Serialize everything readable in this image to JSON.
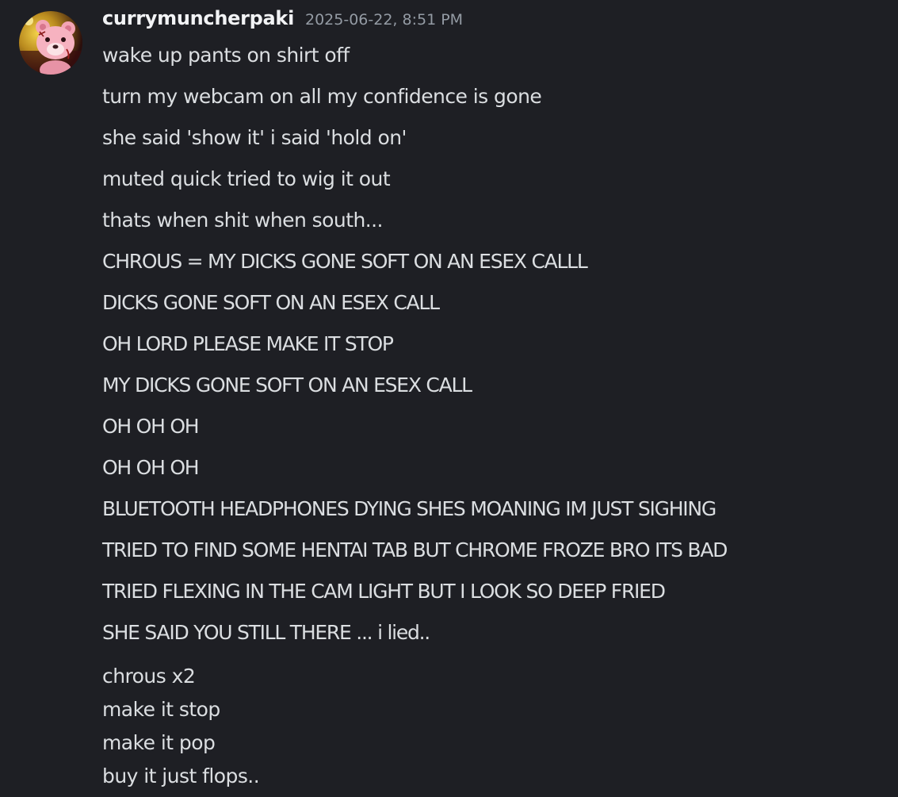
{
  "message": {
    "author": {
      "username": "currymuncherpaki",
      "avatar_icon": "pink-bear-avatar-icon"
    },
    "timestamp": "2025-06-22, 8:51 PM",
    "lines": [
      "wake up pants on shirt off",
      "turn my webcam on all my confidence is gone",
      "she said 'show it' i said 'hold on'",
      "muted quick tried to wig it out",
      "thats when shit when south...",
      "CHROUS = MY DICKS GONE SOFT ON AN ESEX CALLL",
      "DICKS GONE SOFT ON AN ESEX CALL",
      "OH LORD PLEASE MAKE IT STOP",
      "MY DICKS GONE SOFT ON AN ESEX CALL",
      "OH OH OH",
      "OH OH OH",
      "BLUETOOTH HEADPHONES DYING SHES MOANING IM JUST SIGHING",
      "TRIED TO FIND SOME HENTAI TAB BUT CHROME FROZE BRO ITS BAD",
      "TRIED FLEXING IN THE CAM LIGHT BUT I LOOK SO DEEP FRIED",
      "SHE SAID YOU STILL THERE ... i lied.."
    ],
    "final_message": [
      "chrous x2",
      "make it stop",
      "make it pop",
      "buy it just flops.."
    ]
  },
  "colors": {
    "background": "#1e1f24",
    "username": "#f2f3f5",
    "timestamp": "#949ba4",
    "text": "#dbdee1"
  }
}
